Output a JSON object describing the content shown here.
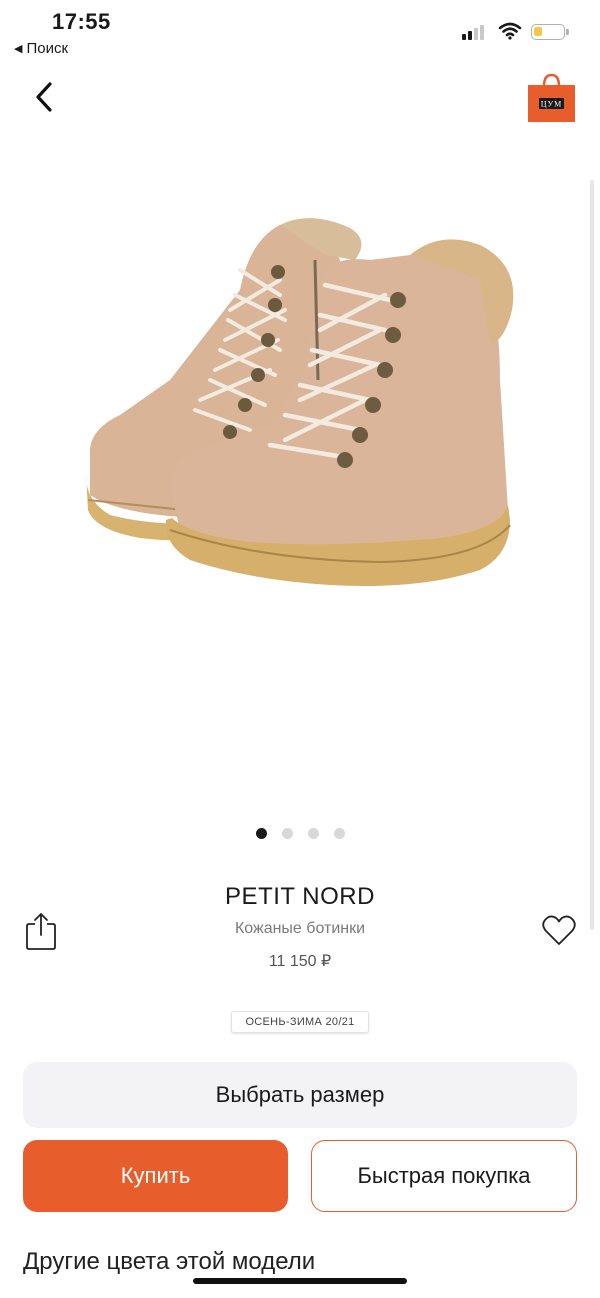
{
  "status_bar": {
    "time": "17:55",
    "back_app_label": "Поиск",
    "back_arrow": "◀",
    "battery_color": "#f2c94c"
  },
  "nav": {
    "back_icon": "chevron-left-icon",
    "store_icon": "shopping-bag-icon",
    "store_logo_text": "ЦУМ"
  },
  "gallery": {
    "image_subject": "children boots",
    "slide_count": 4,
    "active_slide": 1
  },
  "product": {
    "brand": "PETIT NORD",
    "name": "Кожаные ботинки",
    "price": "11 150 ₽",
    "season_badge": "ОСЕНЬ-ЗИМА 20/21"
  },
  "actions": {
    "share_icon": "share-icon",
    "favorite_icon": "heart-icon",
    "select_size": "Выбрать размер",
    "buy": "Купить",
    "quick_buy": "Быстрая покупка"
  },
  "section": {
    "other_colors": "Другие цвета этой модели"
  },
  "colors": {
    "accent": "#e85d2c",
    "size_button_bg": "#f3f3f6"
  }
}
